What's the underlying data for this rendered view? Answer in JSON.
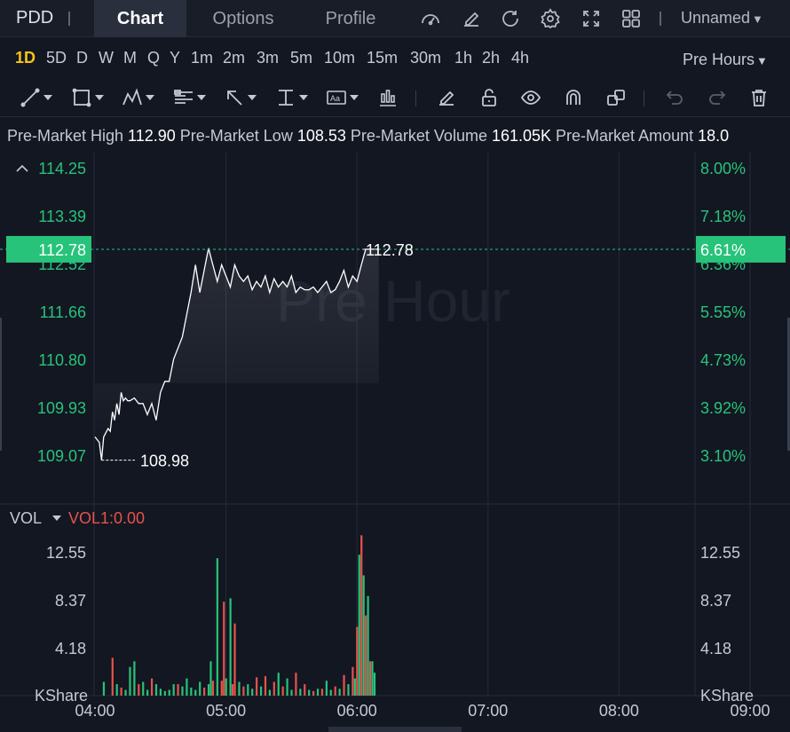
{
  "header": {
    "symbol": "PDD",
    "tabs": [
      {
        "label": "Chart",
        "active": true
      },
      {
        "label": "Options",
        "active": false
      },
      {
        "label": "Profile",
        "active": false
      }
    ],
    "icons": [
      "indicator-gauge-icon",
      "edit-icon",
      "refresh-icon",
      "settings-gear-icon",
      "fullscreen-icon",
      "grid-layout-icon"
    ],
    "layout_name": "Unnamed"
  },
  "timeframes": [
    {
      "label": "1D",
      "active": true
    },
    {
      "label": "5D"
    },
    {
      "label": "D"
    },
    {
      "label": "W"
    },
    {
      "label": "M"
    },
    {
      "label": "Q"
    },
    {
      "label": "Y"
    },
    {
      "label": "1m"
    },
    {
      "label": "2m"
    },
    {
      "label": "3m"
    },
    {
      "label": "5m"
    },
    {
      "label": "10m"
    },
    {
      "label": "15m"
    },
    {
      "label": "30m"
    },
    {
      "label": "1h"
    },
    {
      "label": "2h"
    },
    {
      "label": "4h"
    }
  ],
  "session_selector": "Pre Hours",
  "draw_tools": [
    "trendline-icon",
    "rectangle-icon",
    "pattern-icon",
    "fib-icon",
    "arrow-icon",
    "measure-icon",
    "text-icon",
    "candles-icon",
    "pencil-icon",
    "unlock-icon",
    "eye-icon",
    "magnet-icon",
    "clone-icon",
    "undo-icon",
    "redo-icon",
    "trash-icon"
  ],
  "stats": [
    {
      "label": "Pre-Market High",
      "value": "112.90"
    },
    {
      "label": "Pre-Market Low",
      "value": "108.53"
    },
    {
      "label": "Pre-Market Volume",
      "value": "161.05K"
    },
    {
      "label": "Pre-Market Amount",
      "value": "18.0"
    }
  ],
  "watermark": "Pre Hour",
  "colors": {
    "up": "#27c37a",
    "down": "#e5534b",
    "price_line": "#ffffff",
    "axis_green": "#27c37a",
    "grid": "#262b38",
    "background": "#131722"
  },
  "chart_data": {
    "type": "line",
    "price_ticks": [
      "114.25",
      "113.39",
      "112.52",
      "111.66",
      "110.80",
      "109.93",
      "109.07"
    ],
    "percent_ticks": [
      "8.00%",
      "7.18%",
      "6.36%",
      "5.55%",
      "4.73%",
      "3.92%",
      "3.10%"
    ],
    "current_price": "112.78",
    "current_percent": "6.61%",
    "current_price_label": "112.78",
    "low_label": "108.98",
    "ylim": [
      108.6,
      114.5
    ],
    "time_ticks": [
      "04:00",
      "05:00",
      "06:00",
      "07:00",
      "08:00",
      "09:00"
    ],
    "x_minutes_range": [
      0,
      300
    ],
    "series": [
      {
        "x": [
          0,
          2,
          3,
          4,
          6,
          7,
          8,
          9,
          10,
          11,
          12,
          13,
          14,
          15,
          16,
          18,
          20,
          22,
          24,
          26,
          28,
          30,
          32,
          34,
          36,
          38,
          40,
          42,
          44,
          46,
          48,
          50,
          52,
          54,
          56,
          58,
          60,
          62,
          64,
          66,
          68,
          70,
          72,
          74,
          76,
          78,
          80,
          82,
          84,
          86,
          88,
          90,
          92,
          94,
          96,
          98,
          100,
          102,
          104,
          106,
          108,
          110,
          112,
          114,
          116,
          118,
          120,
          122,
          124,
          126,
          128,
          130
        ],
        "y": [
          109.4,
          109.3,
          108.98,
          109.4,
          109.55,
          109.5,
          109.85,
          109.7,
          110.0,
          109.8,
          110.2,
          110.05,
          110.1,
          110.05,
          110.05,
          110.1,
          110.0,
          110.0,
          109.8,
          110.0,
          109.7,
          110.2,
          110.4,
          110.4,
          110.8,
          111.0,
          111.2,
          111.6,
          112.0,
          112.5,
          112.0,
          112.4,
          112.8,
          112.5,
          112.2,
          112.5,
          112.3,
          112.1,
          112.5,
          112.3,
          112.2,
          112.3,
          112.05,
          112.2,
          112.1,
          112.3,
          112.0,
          112.25,
          112.1,
          112.2,
          112.1,
          112.3,
          112.0,
          112.1,
          112.05,
          112.05,
          112.1,
          112.0,
          112.1,
          112.2,
          112.0,
          112.05,
          112.2,
          112.4,
          112.1,
          112.3,
          112.2,
          112.5,
          112.78,
          112.78,
          112.78,
          112.78
        ]
      }
    ],
    "volume": {
      "label": "VOL",
      "indicator_label": "VOL1:0.00",
      "ticks": [
        "12.55",
        "8.37",
        "4.18"
      ],
      "unit": "KShare",
      "ylim": [
        0,
        14.5
      ],
      "bars": [
        {
          "x": 4,
          "v": 1.2,
          "up": true
        },
        {
          "x": 8,
          "v": 3.3,
          "up": false
        },
        {
          "x": 10,
          "v": 1.0,
          "up": true
        },
        {
          "x": 12,
          "v": 0.7,
          "up": false
        },
        {
          "x": 14,
          "v": 0.5,
          "up": true
        },
        {
          "x": 16,
          "v": 2.5,
          "up": true
        },
        {
          "x": 18,
          "v": 3.0,
          "up": true
        },
        {
          "x": 20,
          "v": 1.0,
          "up": false
        },
        {
          "x": 22,
          "v": 1.2,
          "up": true
        },
        {
          "x": 24,
          "v": 0.5,
          "up": true
        },
        {
          "x": 26,
          "v": 1.5,
          "up": false
        },
        {
          "x": 28,
          "v": 1.0,
          "up": true
        },
        {
          "x": 30,
          "v": 0.6,
          "up": true
        },
        {
          "x": 32,
          "v": 0.4,
          "up": true
        },
        {
          "x": 34,
          "v": 0.5,
          "up": true
        },
        {
          "x": 36,
          "v": 1.0,
          "up": true
        },
        {
          "x": 38,
          "v": 1.0,
          "up": false
        },
        {
          "x": 40,
          "v": 0.8,
          "up": true
        },
        {
          "x": 42,
          "v": 1.5,
          "up": true
        },
        {
          "x": 44,
          "v": 0.7,
          "up": true
        },
        {
          "x": 46,
          "v": 0.5,
          "up": true
        },
        {
          "x": 48,
          "v": 1.2,
          "up": true
        },
        {
          "x": 50,
          "v": 0.7,
          "up": false
        },
        {
          "x": 52,
          "v": 1.0,
          "up": true
        },
        {
          "x": 53,
          "v": 3.0,
          "up": true
        },
        {
          "x": 54,
          "v": 1.3,
          "up": false
        },
        {
          "x": 56,
          "v": 12.0,
          "up": true
        },
        {
          "x": 58,
          "v": 1.3,
          "up": false
        },
        {
          "x": 59,
          "v": 8.2,
          "up": false
        },
        {
          "x": 60,
          "v": 1.5,
          "up": true
        },
        {
          "x": 62,
          "v": 8.5,
          "up": true
        },
        {
          "x": 63,
          "v": 1.0,
          "up": false
        },
        {
          "x": 64,
          "v": 6.3,
          "up": false
        },
        {
          "x": 66,
          "v": 1.2,
          "up": true
        },
        {
          "x": 68,
          "v": 0.8,
          "up": false
        },
        {
          "x": 70,
          "v": 1.0,
          "up": true
        },
        {
          "x": 72,
          "v": 0.6,
          "up": true
        },
        {
          "x": 74,
          "v": 1.6,
          "up": false
        },
        {
          "x": 76,
          "v": 0.8,
          "up": true
        },
        {
          "x": 78,
          "v": 1.7,
          "up": false
        },
        {
          "x": 80,
          "v": 0.5,
          "up": true
        },
        {
          "x": 82,
          "v": 1.2,
          "up": false
        },
        {
          "x": 84,
          "v": 2.0,
          "up": true
        },
        {
          "x": 86,
          "v": 0.8,
          "up": false
        },
        {
          "x": 88,
          "v": 1.5,
          "up": true
        },
        {
          "x": 90,
          "v": 0.5,
          "up": true
        },
        {
          "x": 92,
          "v": 2.0,
          "up": false
        },
        {
          "x": 94,
          "v": 0.6,
          "up": true
        },
        {
          "x": 96,
          "v": 1.0,
          "up": false
        },
        {
          "x": 98,
          "v": 0.5,
          "up": true
        },
        {
          "x": 100,
          "v": 0.4,
          "up": false
        },
        {
          "x": 102,
          "v": 0.6,
          "up": true
        },
        {
          "x": 104,
          "v": 0.6,
          "up": false
        },
        {
          "x": 106,
          "v": 1.3,
          "up": true
        },
        {
          "x": 108,
          "v": 0.5,
          "up": true
        },
        {
          "x": 110,
          "v": 0.8,
          "up": false
        },
        {
          "x": 112,
          "v": 0.6,
          "up": true
        },
        {
          "x": 114,
          "v": 1.8,
          "up": false
        },
        {
          "x": 116,
          "v": 1.0,
          "up": true
        },
        {
          "x": 118,
          "v": 2.5,
          "up": false
        },
        {
          "x": 119,
          "v": 1.5,
          "up": true
        },
        {
          "x": 120,
          "v": 6.0,
          "up": false
        },
        {
          "x": 121,
          "v": 12.3,
          "up": true
        },
        {
          "x": 122,
          "v": 14.0,
          "up": false
        },
        {
          "x": 123,
          "v": 10.5,
          "up": true
        },
        {
          "x": 124,
          "v": 7.0,
          "up": false
        },
        {
          "x": 125,
          "v": 8.7,
          "up": true
        },
        {
          "x": 126,
          "v": 3.0,
          "up": false
        },
        {
          "x": 127,
          "v": 3.0,
          "up": true
        },
        {
          "x": 128,
          "v": 2.0,
          "up": true
        }
      ]
    }
  }
}
